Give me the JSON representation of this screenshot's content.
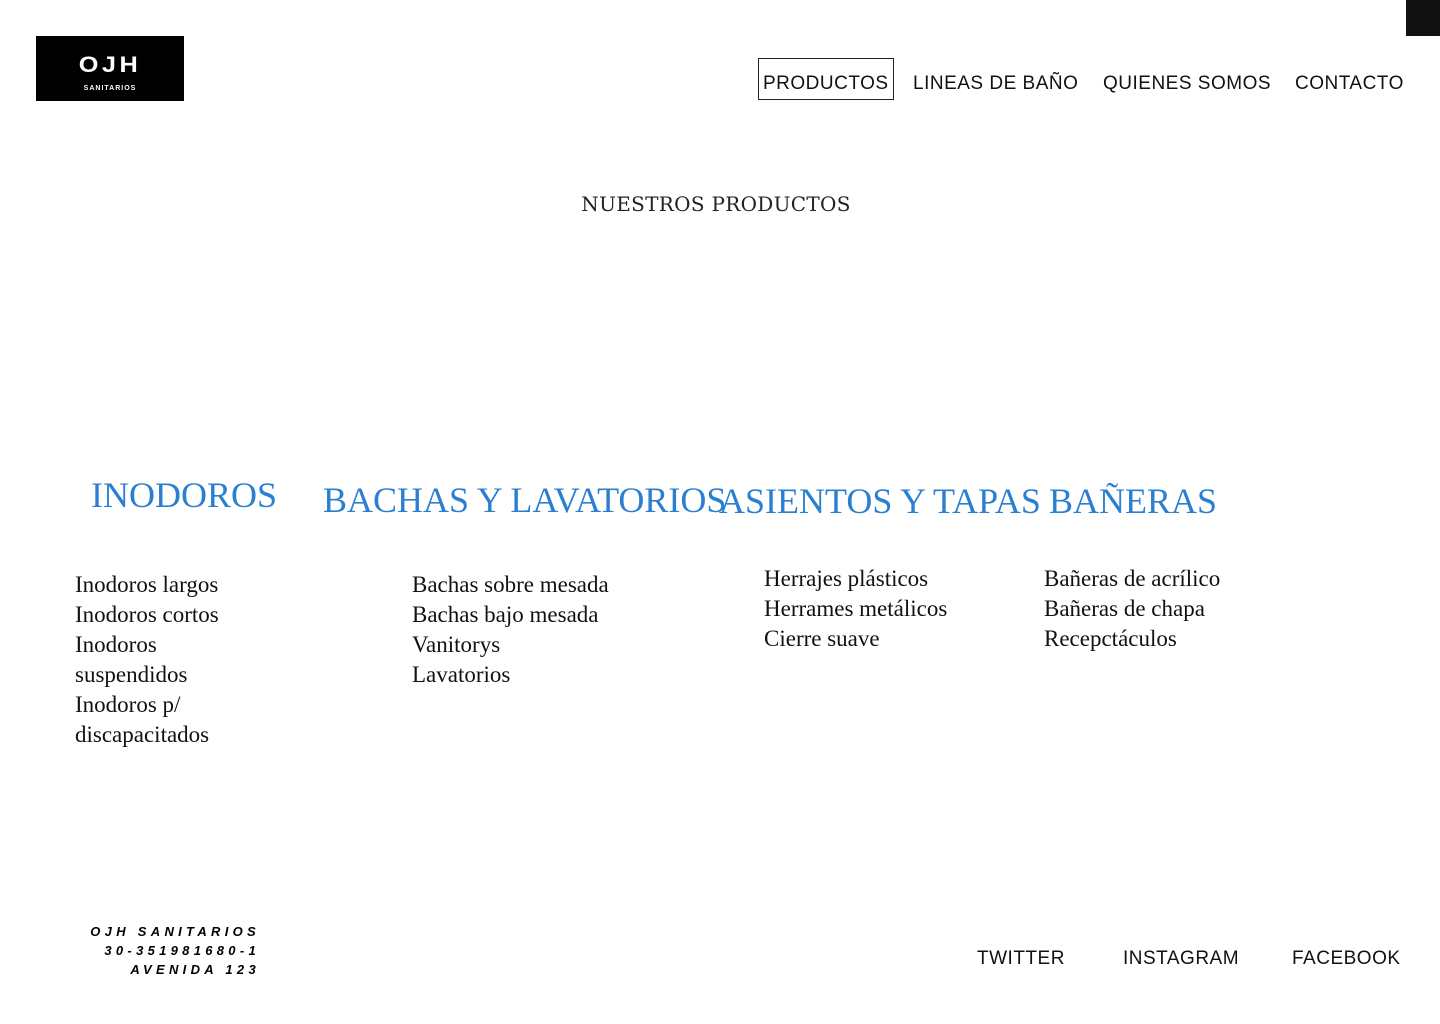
{
  "brand": {
    "logo_main": "OJH",
    "logo_sub": "SANITARIOS"
  },
  "nav": {
    "items": [
      {
        "label": "PRODUCTOS",
        "active": true
      },
      {
        "label": "LINEAS DE BAÑO",
        "active": false
      },
      {
        "label": "QUIENES SOMOS",
        "active": false
      },
      {
        "label": "CONTACTO",
        "active": false
      }
    ]
  },
  "main": {
    "title": "NUESTROS PRODUCTOS",
    "categories": [
      {
        "heading": "INODOROS",
        "items": [
          "Inodoros largos",
          "Inodoros cortos",
          "Inodoros suspendidos",
          "Inodoros p/ discapacitados"
        ]
      },
      {
        "heading": "BACHAS Y LAVATORIOS",
        "items": [
          "Bachas sobre mesada",
          "Bachas bajo mesada",
          "Vanitorys",
          "Lavatorios"
        ]
      },
      {
        "heading": "ASIENTOS Y TAPAS",
        "items": [
          "Herrajes plásticos",
          "Herrames metálicos",
          "Cierre suave"
        ]
      },
      {
        "heading": "BAÑERAS",
        "items": [
          "Bañeras de acrílico",
          "Bañeras de chapa",
          "Recepctáculos"
        ]
      }
    ]
  },
  "footer": {
    "company": "OJH SANITARIOS",
    "phone": "30-351981680-1",
    "address": "AVENIDA 123",
    "social": [
      "TWITTER",
      "INSTAGRAM",
      "FACEBOOK"
    ]
  },
  "colors": {
    "accent": "#2a7fd0",
    "logo_bg": "#000000",
    "text": "#111111"
  }
}
